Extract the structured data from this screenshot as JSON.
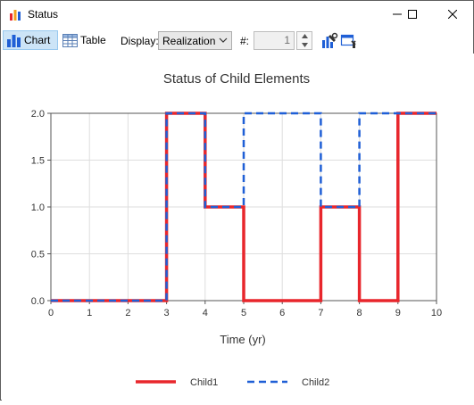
{
  "window": {
    "title": "Status"
  },
  "toolbar": {
    "chart_label": "Chart",
    "table_label": "Table",
    "display_label": "Display:",
    "display_value": "Realization",
    "count_label": "#:",
    "count_value": "1"
  },
  "colors": {
    "child1": "#e8262c",
    "child2": "#1f5fd6",
    "grid": "#dedede"
  },
  "chart_data": {
    "type": "line",
    "title": "Status of Child Elements",
    "xlabel": "Time (yr)",
    "ylabel": "",
    "xlim": [
      0,
      10
    ],
    "ylim": [
      0,
      2
    ],
    "x_ticks": [
      "0",
      "1",
      "2",
      "3",
      "4",
      "5",
      "6",
      "7",
      "8",
      "9",
      "10"
    ],
    "y_ticks": [
      "0.0",
      "0.5",
      "1.0",
      "1.5",
      "2.0"
    ],
    "grid": true,
    "legend": "bottom",
    "step": true,
    "series": [
      {
        "name": "Child1",
        "style": "solid",
        "x": [
          0,
          3,
          4,
          5,
          7,
          8,
          9,
          10
        ],
        "y": [
          0,
          2,
          1,
          0,
          1,
          0,
          2,
          2
        ]
      },
      {
        "name": "Child2",
        "style": "dashed",
        "x": [
          0,
          3,
          4,
          5,
          7,
          8,
          9,
          10
        ],
        "y": [
          0,
          2,
          1,
          2,
          1,
          2,
          2,
          2
        ]
      }
    ]
  }
}
